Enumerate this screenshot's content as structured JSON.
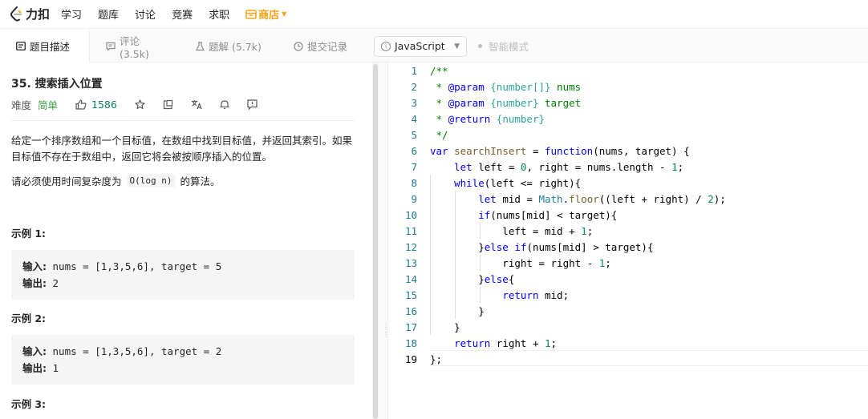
{
  "nav": {
    "logo_text": "力扣",
    "items": [
      "学习",
      "题库",
      "讨论",
      "竞赛",
      "求职"
    ],
    "shop": "商店"
  },
  "tabs": {
    "description": "题目描述",
    "comments": "评论 (3.5k)",
    "solutions": "题解 (5.7k)",
    "submissions": "提交记录"
  },
  "editor_toolbar": {
    "language": "JavaScript",
    "smart_mode": "智能模式"
  },
  "problem": {
    "title": "35. 搜索插入位置",
    "difficulty_label": "难度",
    "difficulty": "简单",
    "likes": "1586",
    "description": "给定一个排序数组和一个目标值，在数组中找到目标值，并返回其索引。如果目标值不存在于数组中，返回它将会被按顺序插入的位置。",
    "complexity_prefix": "请必须使用时间复杂度为",
    "complexity_code": "O(log n)",
    "complexity_suffix": "的算法。",
    "examples": [
      {
        "title": "示例 1:",
        "input_label": "输入:",
        "input": "nums = [1,3,5,6], target = 5",
        "output_label": "输出:",
        "output": "2"
      },
      {
        "title": "示例 2:",
        "input_label": "输入:",
        "input": "nums = [1,3,5,6], target = 2",
        "output_label": "输出:",
        "output": "1"
      },
      {
        "title": "示例 3:"
      }
    ]
  },
  "code": {
    "line_numbers": [
      "1",
      "2",
      "3",
      "4",
      "5",
      "6",
      "7",
      "8",
      "9",
      "10",
      "11",
      "12",
      "13",
      "14",
      "15",
      "16",
      "17",
      "18",
      "19"
    ],
    "lines": [
      "/**",
      " * @param {number[]} nums",
      " * @param {number} target",
      " * @return {number}",
      " */",
      "var searchInsert = function(nums, target) {",
      "    let left = 0, right = nums.length - 1;",
      "    while(left <= right){",
      "        let mid = Math.floor((left + right) / 2);",
      "        if(nums[mid] < target){",
      "            left = mid + 1;",
      "        }else if(nums[mid] > target){",
      "            right = right - 1;",
      "        }else{",
      "            return mid;",
      "        }",
      "    }",
      "    return right + 1;",
      "};"
    ]
  },
  "colors": {
    "accent": "#ffa116",
    "easy": "#43a047",
    "line_number": "#237893"
  }
}
